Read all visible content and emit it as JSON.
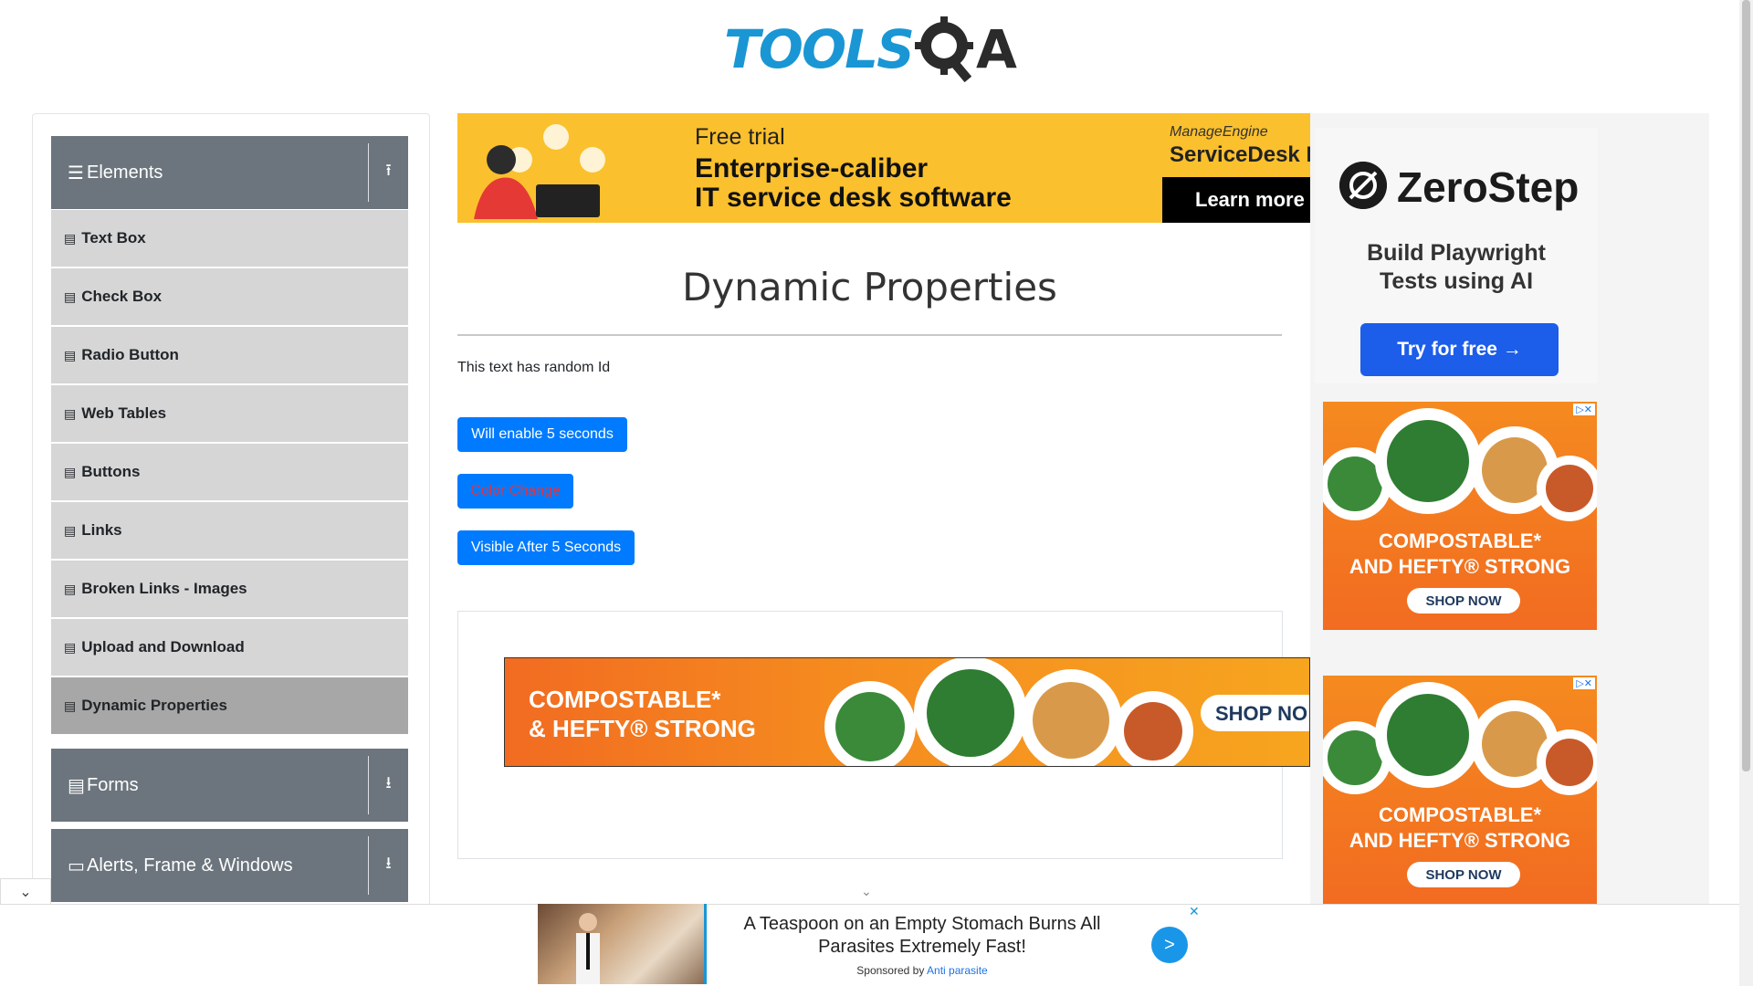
{
  "header": {
    "logo_text": "TOOLS",
    "logo_suffix": "A"
  },
  "sidebar": {
    "groups": [
      {
        "label": "Elements",
        "icon": "menu-icon",
        "toggle_icon": "arrow-up-icon"
      },
      {
        "label": "Forms",
        "icon": "document-icon",
        "toggle_icon": "arrow-down-icon"
      },
      {
        "label": "Alerts, Frame & Windows",
        "icon": "window-icon",
        "toggle_icon": "arrow-down-icon"
      }
    ],
    "items": [
      {
        "label": "Text Box"
      },
      {
        "label": "Check Box"
      },
      {
        "label": "Radio Button"
      },
      {
        "label": "Web Tables"
      },
      {
        "label": "Buttons"
      },
      {
        "label": "Links"
      },
      {
        "label": "Broken Links - Images"
      },
      {
        "label": "Upload and Download"
      },
      {
        "label": "Dynamic Properties",
        "active": true
      }
    ]
  },
  "ads": {
    "top_banner": {
      "line1": "Free trial",
      "line2": "Enterprise-caliber",
      "line3": "IT service desk software",
      "brand_small": "ManageEngine",
      "brand": "ServiceDesk Pl",
      "cta": "Learn more"
    },
    "hefty_wide": {
      "line1": "COMPOSTABLE*",
      "line2": "& HEFTY® STRONG",
      "cta": "SHOP NO"
    },
    "zerostep": {
      "brand": "ZeroStep",
      "tagline_1": "Build Playwright",
      "tagline_2": "Tests using AI",
      "cta": "Try for free →"
    },
    "hefty_square": {
      "line1": "COMPOSTABLE*",
      "line2": "AND HEFTY® STRONG",
      "cta": "SHOP NOW",
      "adchoice": "▷✕"
    },
    "bottom": {
      "headline": "A Teaspoon on an Empty Stomach Burns All Parasites Extremely Fast!",
      "sponsor_prefix": "Sponsored by",
      "sponsor_name": "Anti parasite",
      "go": ">",
      "close": "✕"
    }
  },
  "main": {
    "title": "Dynamic Properties",
    "random_text": "This text has random Id",
    "btn_enable": "Will enable 5 seconds",
    "btn_color": "Color Change",
    "btn_visible": "Visible After 5 Seconds"
  },
  "colors": {
    "primary": "#007bff",
    "sidebar_header": "#6c757d",
    "sidebar_item": "#d6d6d6",
    "sidebar_active": "#a7a7a7",
    "danger_text": "#dc3545"
  }
}
